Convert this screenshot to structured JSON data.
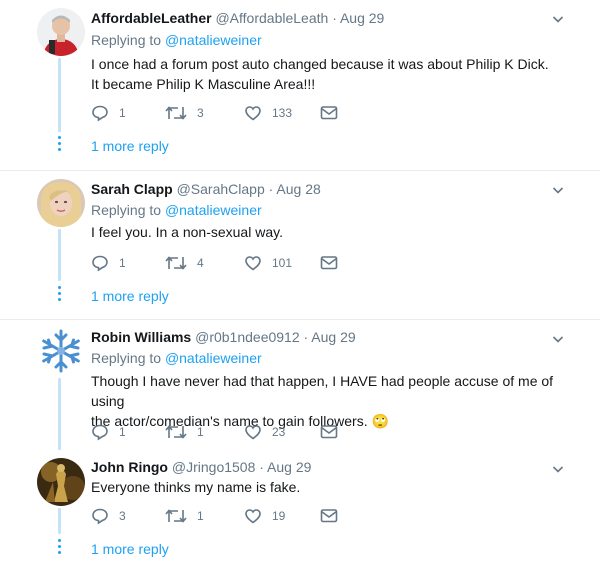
{
  "tweets": [
    {
      "name": "AffordableLeather",
      "handle": "@AffordableLeath",
      "date": "· Aug 29",
      "replying_prefix": "Replying to",
      "replying_to": "@natalieweiner",
      "text_lines": [
        "I once had a forum post auto changed because it was about Philip K Dick.",
        "It became Philip K Masculine Area!!!"
      ],
      "replies": "1",
      "retweets": "3",
      "likes": "133",
      "avatar_icon": "man-red-shirt-avatar"
    },
    {
      "name": "Sarah Clapp",
      "handle": "@SarahClapp",
      "date": "· Aug 28",
      "replying_prefix": "Replying to",
      "replying_to": "@natalieweiner",
      "text_lines": [
        "I feel you. In a non-sexual way."
      ],
      "replies": "1",
      "retweets": "4",
      "likes": "101",
      "avatar_icon": "blonde-woman-avatar"
    },
    {
      "name": "Robin Williams",
      "handle": "@r0b1ndee0912",
      "date": "· Aug 29",
      "replying_prefix": "Replying to",
      "replying_to": "@natalieweiner",
      "text_lines": [
        "Though I have never had that happen, I HAVE had people accuse of me of using",
        "the actor/comedian's name to gain followers."
      ],
      "emoji": "🙄",
      "replies": "1",
      "retweets": "1",
      "likes": "23",
      "avatar_icon": "snowflake-avatar"
    },
    {
      "name": "John Ringo",
      "handle": "@Jringo1508",
      "date": "· Aug 29",
      "text_lines": [
        "Everyone thinks my name is fake."
      ],
      "replies": "3",
      "retweets": "1",
      "likes": "19",
      "avatar_icon": "armored-figure-avatar"
    }
  ],
  "more_reply_label": "1 more reply",
  "colors": {
    "link": "#1da1f2",
    "muted": "#657786",
    "thread": "#c4e3f7",
    "divider": "#e6ecf0"
  }
}
